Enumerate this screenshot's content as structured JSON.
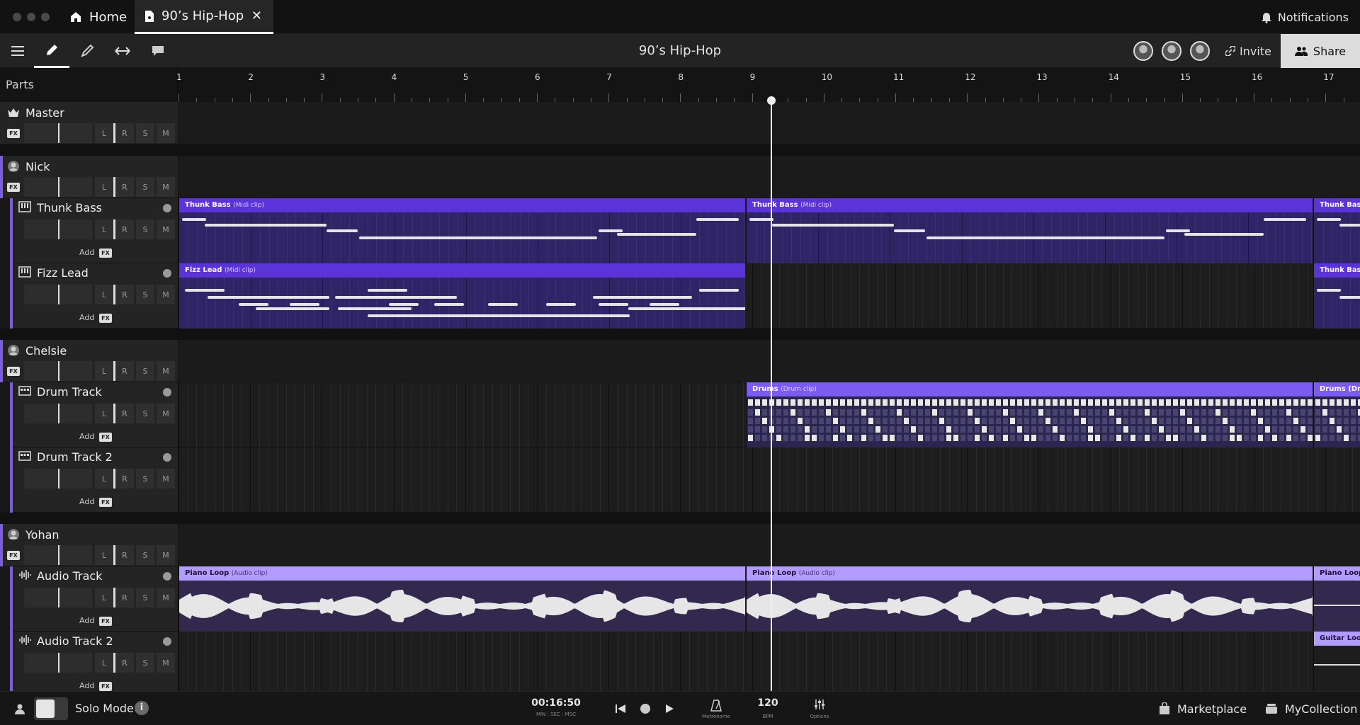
{
  "tabs": [
    {
      "label": "Home"
    },
    {
      "label": "90’s Hip-Hop"
    }
  ],
  "notifications_label": "Notifications",
  "doc_title": "90’s Hip-Hop",
  "invite_label": "Invite",
  "share_label": "Share",
  "parts_label": "Parts",
  "bars": [
    "1",
    "2",
    "3",
    "4",
    "5",
    "6",
    "7",
    "8",
    "9",
    "10",
    "11",
    "12",
    "13",
    "14",
    "15",
    "16",
    "17"
  ],
  "button_labels": {
    "L": "L",
    "R": "R",
    "S": "S",
    "M": "M",
    "fx": "FX",
    "add": "Add"
  },
  "groups": [
    {
      "name": "Master"
    },
    {
      "name": "Nick"
    },
    {
      "name": "Chelsie"
    },
    {
      "name": "Yohan"
    }
  ],
  "tracks": [
    {
      "name": "Thunk Bass"
    },
    {
      "name": "Fizz Lead"
    },
    {
      "name": "Drum Track"
    },
    {
      "name": "Drum Track 2"
    },
    {
      "name": "Audio Track"
    },
    {
      "name": "Audio Track 2"
    }
  ],
  "clips": {
    "thunk1": {
      "name": "Thunk Bass",
      "type": "(Midi clip)"
    },
    "thunk2": {
      "name": "Thunk Bass",
      "type": "(Midi clip)"
    },
    "thunk3": {
      "name": "Thunk Bass"
    },
    "fizz1": {
      "name": "Fizz Lead",
      "type": "(Midi clip)"
    },
    "fizz2": {
      "name": "Thunk Bass"
    },
    "drums1": {
      "name": "Drums",
      "type": "(Drum clip)"
    },
    "drums2": {
      "name": "Drums (Dru"
    },
    "piano1": {
      "name": "Piano Loop",
      "type": "(Audio clip)"
    },
    "piano2": {
      "name": "Piano Loop",
      "type": "(Audio clip)"
    },
    "piano3": {
      "name": "Piano Loop"
    },
    "guitar": {
      "name": "Guitar Loop"
    }
  },
  "transport": {
    "time": "00:16:50",
    "time_units": "MIN : SEC : MSC",
    "bpm": "120",
    "bpm_label": "BPM",
    "metronome_label": "Metronome",
    "options_label": "Options"
  },
  "solo_mode_label": "Solo Mode",
  "marketplace_label": "Marketplace",
  "collection_label": "MyCollection",
  "colors": {
    "accent": "#7c5ce0",
    "midi_clip": "#5233c8",
    "drum_clip": "#7b5cf0",
    "audio_clip": "#b39cff"
  }
}
